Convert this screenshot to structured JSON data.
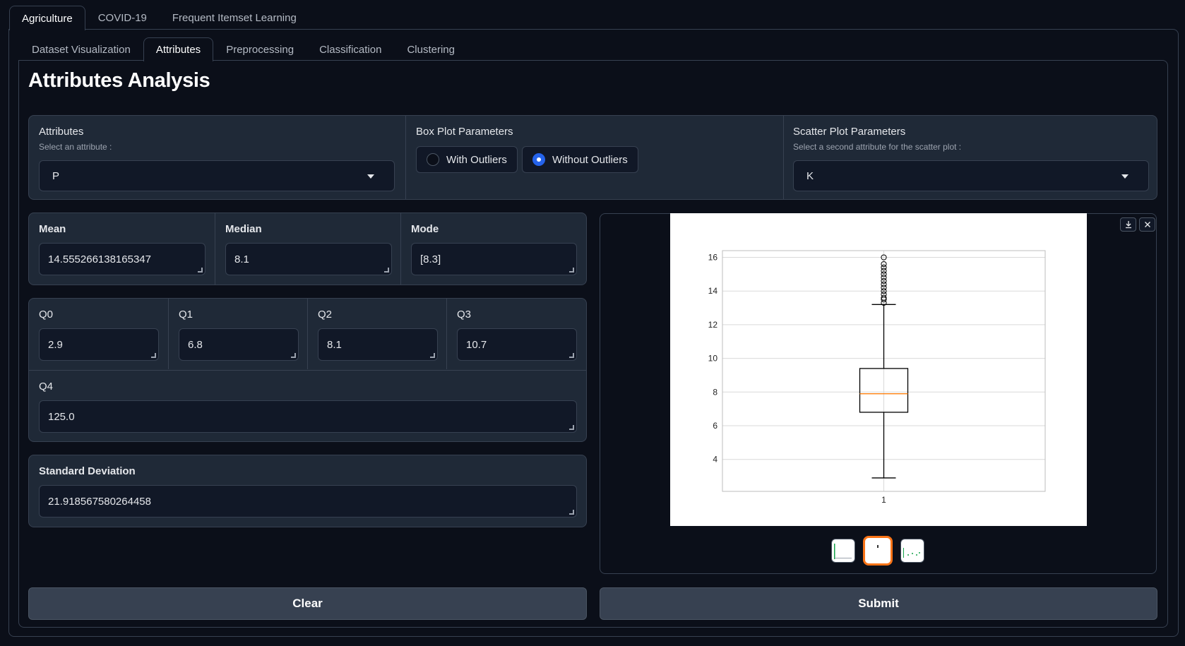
{
  "top_tabs": [
    {
      "label": "Agriculture",
      "active": true
    },
    {
      "label": "COVID-19",
      "active": false
    },
    {
      "label": "Frequent Itemset Learning",
      "active": false
    }
  ],
  "sub_tabs": [
    {
      "label": "Dataset Visualization",
      "active": false
    },
    {
      "label": "Attributes",
      "active": true
    },
    {
      "label": "Preprocessing",
      "active": false
    },
    {
      "label": "Classification",
      "active": false
    },
    {
      "label": "Clustering",
      "active": false
    }
  ],
  "page_title": "Attributes Analysis",
  "attributes": {
    "label": "Attributes",
    "sublabel": "Select an attribute :",
    "value": "P"
  },
  "box_params": {
    "label": "Box Plot Parameters",
    "options": [
      {
        "label": "With Outliers",
        "checked": false
      },
      {
        "label": "Without Outliers",
        "checked": true
      }
    ]
  },
  "scatter_params": {
    "label": "Scatter Plot Parameters",
    "sublabel": "Select a second attribute for the scatter plot :",
    "value": "K"
  },
  "stats": {
    "mean": {
      "label": "Mean",
      "value": "14.555266138165347"
    },
    "median": {
      "label": "Median",
      "value": "8.1"
    },
    "mode": {
      "label": "Mode",
      "value": "[8.3]"
    },
    "q0": {
      "label": "Q0",
      "value": "2.9"
    },
    "q1": {
      "label": "Q1",
      "value": "6.8"
    },
    "q2": {
      "label": "Q2",
      "value": "8.1"
    },
    "q3": {
      "label": "Q3",
      "value": "10.7"
    },
    "q4": {
      "label": "Q4",
      "value": "125.0"
    },
    "std": {
      "label": "Standard Deviation",
      "value": "21.918567580264458"
    }
  },
  "buttons": {
    "clear": "Clear",
    "submit": "Submit"
  },
  "icons": {
    "download": "download-icon",
    "close": "close-icon",
    "dropdown": "chevron-down-icon"
  },
  "colors": {
    "accent": "#2563eb",
    "selected_thumb": "#f97316",
    "median_line": "#ff7f0e"
  },
  "chart_data": {
    "type": "box",
    "categories": [
      "1"
    ],
    "yticks": [
      4,
      6,
      8,
      10,
      12,
      14,
      16
    ],
    "ylim": [
      2.1,
      16.4
    ],
    "box": {
      "whisker_low": 2.9,
      "q1": 6.8,
      "median": 7.9,
      "q3": 9.4,
      "whisker_high": 13.2
    },
    "outliers": [
      13.3,
      13.5,
      13.6,
      13.8,
      14.0,
      14.2,
      14.4,
      14.6,
      14.8,
      15.0,
      15.2,
      15.4,
      15.6,
      16.0
    ],
    "grid": true
  }
}
